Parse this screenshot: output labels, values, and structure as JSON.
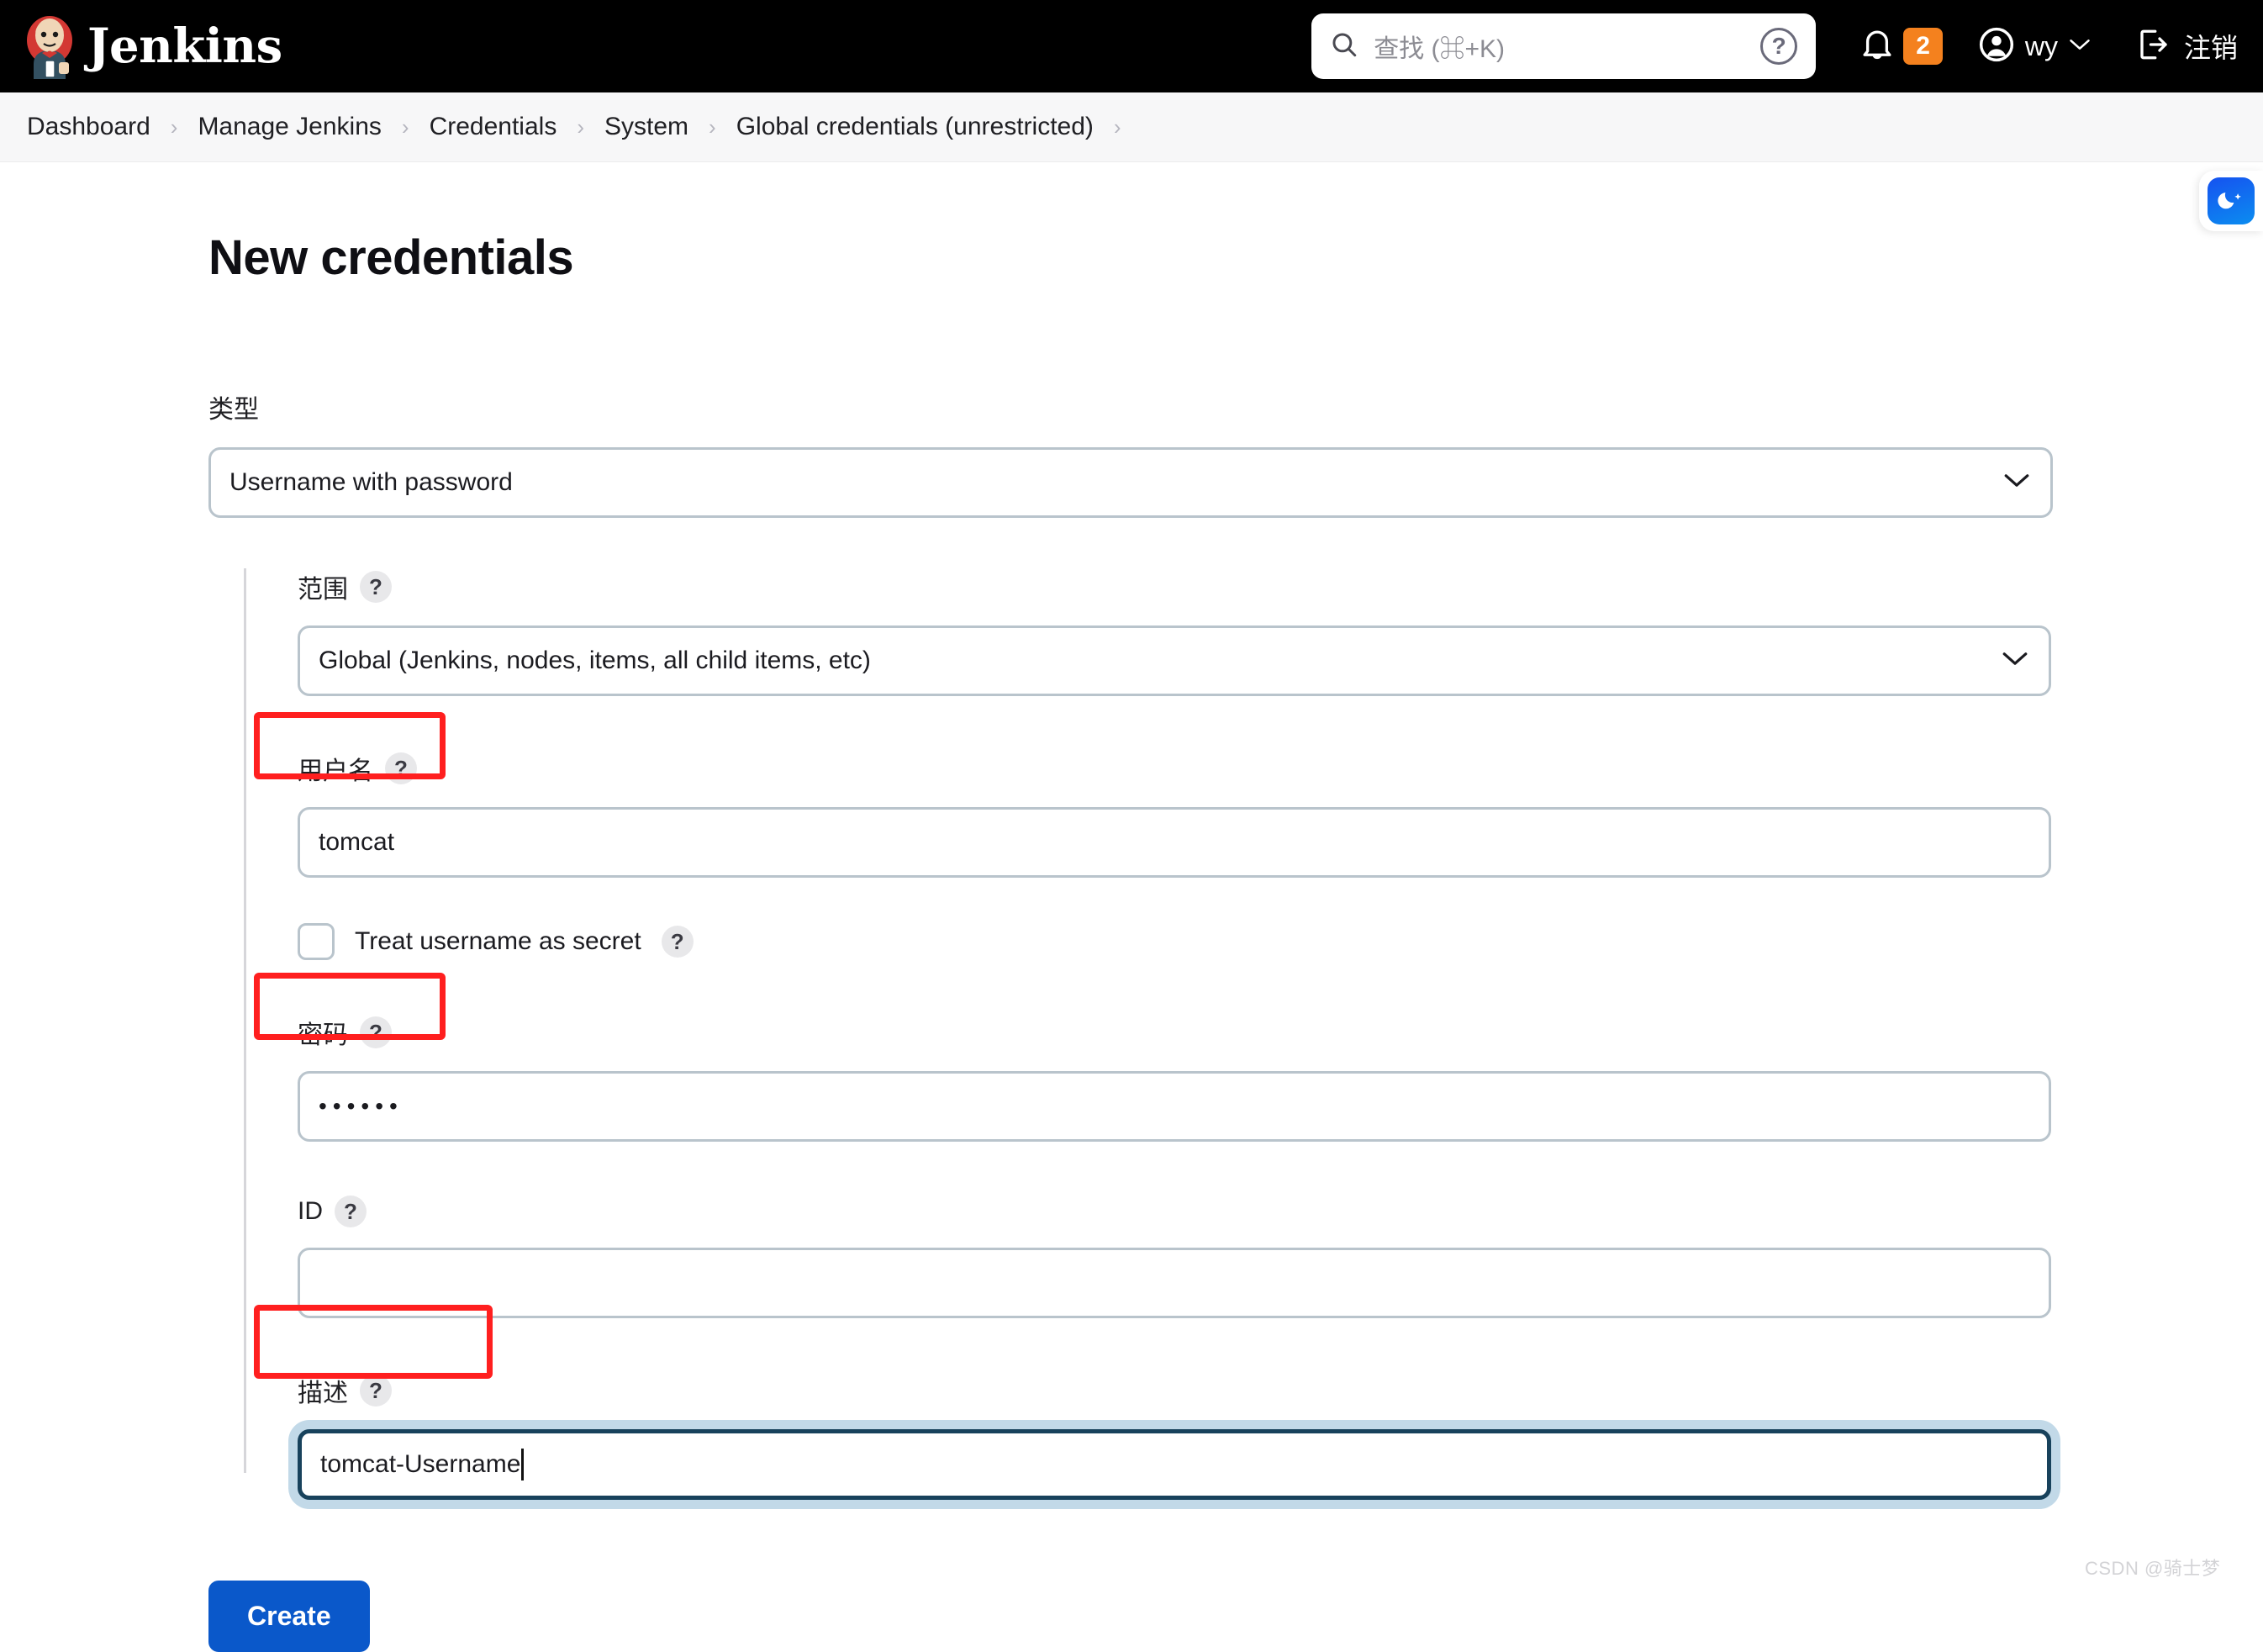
{
  "header": {
    "brand": "Jenkins",
    "brand_icon": "jenkins-butler-logo",
    "search": {
      "placeholder": "查找 (⌘+K)",
      "icon": "search-icon",
      "help_icon": "question-mark-circle-icon"
    },
    "notifications": {
      "icon": "bell-icon",
      "count": "2",
      "badge_color": "#f4811e"
    },
    "user": {
      "icon": "user-circle-icon",
      "name": "wy",
      "chevron": "chevron-down-icon"
    },
    "logout": {
      "icon": "logout-icon",
      "label": "注销"
    }
  },
  "breadcrumbs": [
    {
      "label": "Dashboard"
    },
    {
      "label": "Manage Jenkins"
    },
    {
      "label": "Credentials"
    },
    {
      "label": "System"
    },
    {
      "label": "Global credentials (unrestricted)"
    }
  ],
  "breadcrumb_separator": "›",
  "main": {
    "page_title": "New credentials",
    "type": {
      "label": "类型",
      "selected": "Username with password",
      "chevron": "chevron-down-icon"
    },
    "scope": {
      "label": "范围",
      "help": "?",
      "selected": "Global (Jenkins, nodes, items, all child items, etc)",
      "chevron": "chevron-down-icon"
    },
    "username": {
      "label": "用户名",
      "help": "?",
      "value": "tomcat",
      "highlighted": true
    },
    "treat_secret": {
      "label": "Treat username as secret",
      "help": "?",
      "checked": false
    },
    "password": {
      "label": "密码",
      "help": "?",
      "value": "••••••",
      "highlighted": true
    },
    "id": {
      "label": "ID",
      "help": "?",
      "value": ""
    },
    "description": {
      "label": "描述",
      "help": "?",
      "value": "tomcat-Username",
      "focused": true,
      "highlighted": true
    },
    "submit": {
      "label": "Create",
      "color": "#0a58ca"
    }
  },
  "theme_widget": {
    "icon": "moon-sparkle-icon"
  },
  "watermark": "CSDN @骑士梦"
}
